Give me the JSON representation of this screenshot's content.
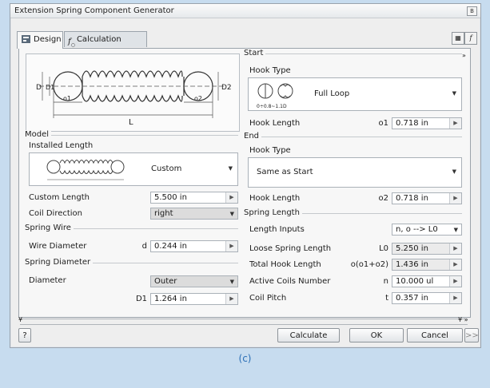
{
  "window": {
    "title": "Extension Spring Component Generator"
  },
  "tabs": [
    {
      "label": "Design"
    },
    {
      "label": "Calculation"
    }
  ],
  "model": {
    "group_label": "Model",
    "installed_length_label": "Installed Length",
    "installed_length_value": "Custom",
    "custom_length_label": "Custom Length",
    "custom_length_value": "5.500 in",
    "coil_direction_label": "Coil Direction",
    "coil_direction_value": "right"
  },
  "spring_wire": {
    "group_label": "Spring Wire",
    "wire_diameter_label": "Wire Diameter",
    "wire_diameter_symbol": "d",
    "wire_diameter_value": "0.244 in"
  },
  "spring_diameter": {
    "group_label": "Spring Diameter",
    "diameter_label": "Diameter",
    "diameter_value": "Outer",
    "d1_symbol": "D1",
    "d1_value": "1.264 in"
  },
  "start": {
    "group_label": "Start",
    "hook_type_label": "Hook Type",
    "hook_type_value": "Full Loop",
    "hook_range": "0÷0.8~1.1D",
    "hook_length_label": "Hook Length",
    "hook_length_symbol": "o1",
    "hook_length_value": "0.718 in"
  },
  "end": {
    "group_label": "End",
    "hook_type_label": "Hook Type",
    "hook_type_value": "Same as Start",
    "hook_length_label": "Hook Length",
    "hook_length_symbol": "o2",
    "hook_length_value": "0.718 in"
  },
  "spring_length": {
    "group_label": "Spring Length",
    "length_inputs_label": "Length Inputs",
    "length_inputs_value": "n, o --> L0",
    "loose_label": "Loose Spring Length",
    "loose_symbol": "L0",
    "loose_value": "5.250 in",
    "total_hook_label": "Total Hook Length",
    "total_hook_symbol": "o(o1+o2)",
    "total_hook_value": "1.436 in",
    "active_coils_label": "Active Coils Number",
    "active_coils_symbol": "n",
    "active_coils_value": "10.000 ul",
    "coil_pitch_label": "Coil Pitch",
    "coil_pitch_symbol": "t",
    "coil_pitch_value": "0.357 in"
  },
  "diagram": {
    "d_label": "D",
    "d1_label": "D1",
    "d2_label": "D2",
    "o1_label": "o1",
    "o2_label": "o2",
    "l_label": "L"
  },
  "buttons": {
    "help": "?",
    "calculate": "Calculate",
    "ok": "OK",
    "cancel": "Cancel",
    "more": ">>"
  },
  "caption": "(c)"
}
